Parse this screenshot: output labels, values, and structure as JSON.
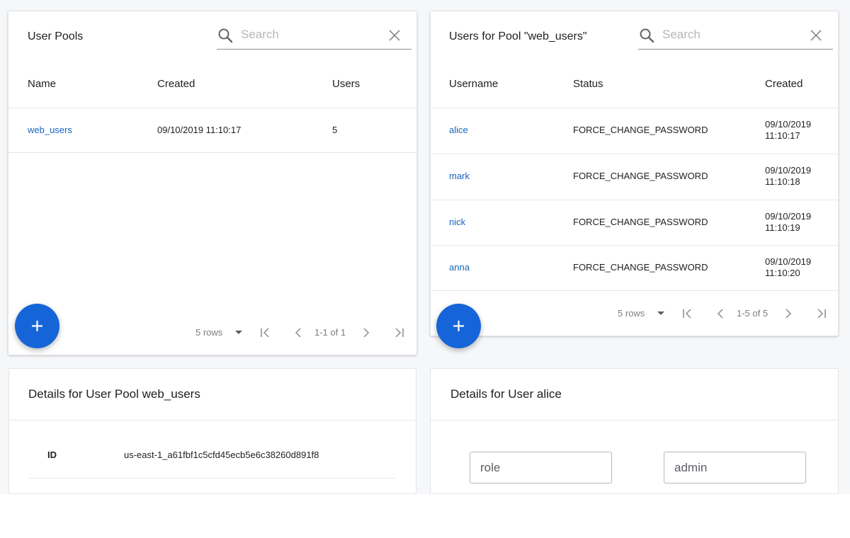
{
  "colors": {
    "accent": "#1665d8",
    "link": "#1565c0",
    "background": "#f6f7f9"
  },
  "user_pools": {
    "title": "User Pools",
    "search": {
      "placeholder": "Search",
      "value": "",
      "icon": "search-icon",
      "clear_icon": "close-icon"
    },
    "columns": [
      "Name",
      "Created",
      "Users"
    ],
    "rows": [
      {
        "name": "web_users",
        "created": "09/10/2019 11:10:17",
        "users": "5"
      }
    ],
    "pagination": {
      "rows_label": "5 rows",
      "range": "1-1 of 1"
    },
    "add_icon": "plus-icon"
  },
  "pool_users": {
    "title": "Users for Pool \"web_users\"",
    "search": {
      "placeholder": "Search",
      "value": "",
      "icon": "search-icon",
      "clear_icon": "close-icon"
    },
    "columns": [
      "Username",
      "Status",
      "Created"
    ],
    "rows": [
      {
        "username": "alice",
        "status": "FORCE_CHANGE_PASSWORD",
        "date": "09/10/2019",
        "time": "11:10:17"
      },
      {
        "username": "mark",
        "status": "FORCE_CHANGE_PASSWORD",
        "date": "09/10/2019",
        "time": "11:10:18"
      },
      {
        "username": "nick",
        "status": "FORCE_CHANGE_PASSWORD",
        "date": "09/10/2019",
        "time": "11:10:19"
      },
      {
        "username": "anna",
        "status": "FORCE_CHANGE_PASSWORD",
        "date": "09/10/2019",
        "time": "11:10:20"
      }
    ],
    "pagination": {
      "rows_label": "5 rows",
      "range": "1-5 of 5"
    },
    "add_icon": "plus-icon"
  },
  "pool_details": {
    "title": "Details for User Pool web_users",
    "fields": [
      {
        "key": "ID",
        "value": "us-east-1_a61fbf1c5cfd45ecb5e6c38260d891f8"
      }
    ]
  },
  "user_details": {
    "title": "Details for User alice",
    "attribute": {
      "name_value": "role",
      "value_value": "admin"
    }
  }
}
